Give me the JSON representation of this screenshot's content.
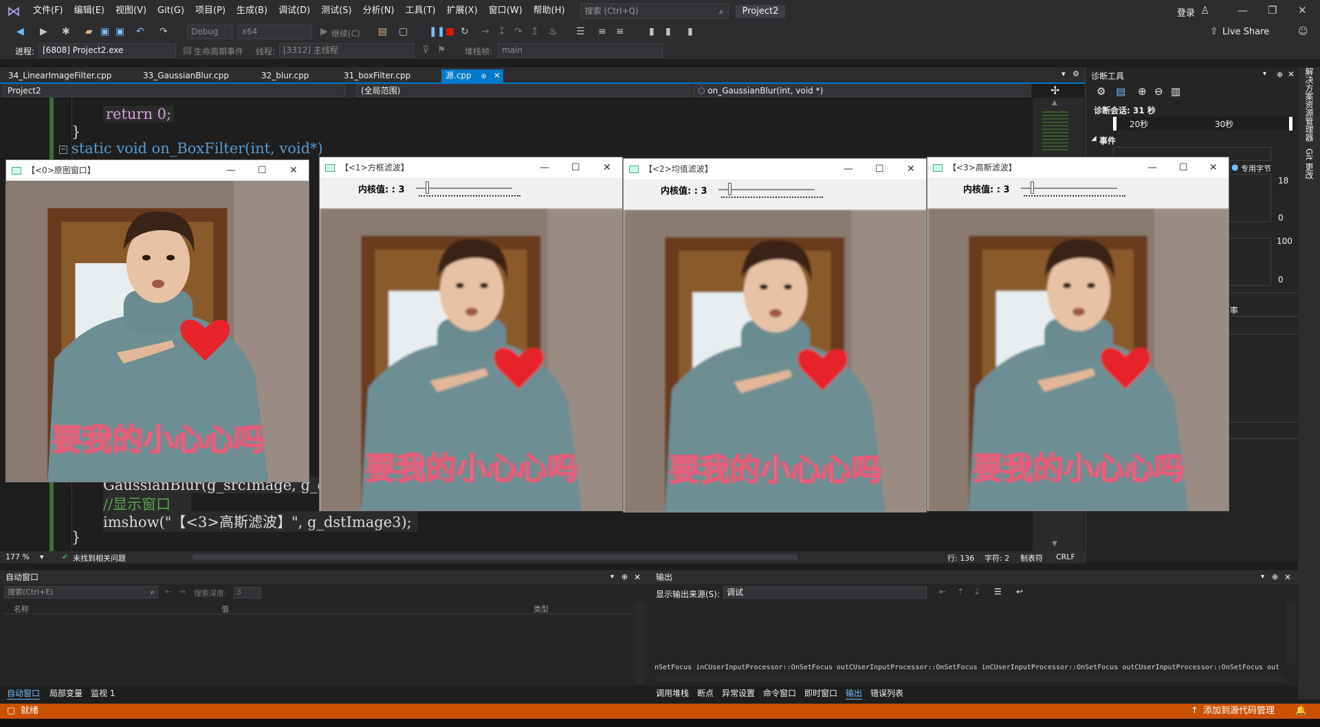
{
  "menu": [
    "文件(F)",
    "编辑(E)",
    "视图(V)",
    "Git(G)",
    "项目(P)",
    "生成(B)",
    "调试(D)",
    "测试(S)",
    "分析(N)",
    "工具(T)",
    "扩展(X)",
    "窗口(W)",
    "帮助(H)"
  ],
  "search_placeholder": "搜索 (Ctrl+Q)",
  "project_name": "Project2",
  "login": "登录",
  "toolbar": {
    "config": "Debug",
    "platform": "x64",
    "continue": "继续(C)",
    "live_share": "Live Share",
    "process_label": "进程:",
    "process_value": "[6808] Project2.exe",
    "lifecycle": "生命周期事件",
    "thread_label": "线程:",
    "thread_value": "[3312] 主线程",
    "stack_label": "堆栈帧:",
    "stack_value": "main"
  },
  "tabs": [
    "34_LinearImageFilter.cpp",
    "33_GaussianBlur.cpp",
    "32_blur.cpp",
    "31_boxFilter.cpp",
    "源.cpp"
  ],
  "nav": {
    "project": "Project2",
    "scope": "(全局范围)",
    "function": "on_GaussianBlur(int, void *)"
  },
  "code": {
    "l1": "return 0;",
    "l2": "}",
    "l3": "static void on_BoxFilter(int, void*)",
    "l4": "GaussianBlur(g_srcImage, g_d",
    "l5": "//显示窗口",
    "l6": "imshow(\"【<3>高斯滤波】\", g_dstImage3);",
    "l7": "}"
  },
  "editor_status": {
    "zoom": "177 %",
    "issues": "未找到相关问题",
    "line": "行: 136",
    "char": "字符: 2",
    "tabs": "制表符",
    "eol": "CRLF"
  },
  "diag": {
    "title": "诊断工具",
    "session": "诊断会话: 31 秒",
    "t20": "20秒",
    "t30": "30秒",
    "events": "事件",
    "private_bytes": "专用字节",
    "v18": "18",
    "v0a": "0",
    "v100": "100",
    "v0b": "0",
    "rate": "率"
  },
  "right_strip": [
    "解决方案资源管理器",
    "Git 更改"
  ],
  "auto_window": {
    "title": "自动窗口",
    "search": "搜索(Ctrl+E)",
    "depth_label": "搜索深度:",
    "depth_value": "3",
    "col_name": "名称",
    "col_value": "值",
    "col_type": "类型"
  },
  "bottom_left_tabs": [
    "自动窗口",
    "局部变量",
    "监视 1"
  ],
  "output": {
    "title": "输出",
    "source_label": "显示输出来源(S):",
    "source_value": "调试",
    "text": "nSetFocus inCUserInputProcessor::OnSetFocus outCUserInputProcessor::OnSetFocus inCUserInputProcessor::OnSetFocus outCUserInputProcessor::OnSetFocus out"
  },
  "bottom_right_tabs": [
    "调用堆栈",
    "断点",
    "异常设置",
    "命令窗口",
    "即时窗口",
    "输出",
    "错误列表"
  ],
  "status": {
    "ready": "就绪",
    "source_control": "添加到源代码管理"
  },
  "cv_windows": [
    {
      "title": "【<0>原图窗口】",
      "has_trackbar": false
    },
    {
      "title": "【<1>方框滤波】",
      "has_trackbar": true,
      "track_label": "内核值: : 3"
    },
    {
      "title": "【<2>均值滤波】",
      "has_trackbar": true,
      "track_label": "内核值: : 3"
    },
    {
      "title": "【<3>高斯滤波】",
      "has_trackbar": true,
      "track_label": "内核值: : 3"
    }
  ],
  "photo_caption": "要我的小心心吗",
  "colors": {
    "accent": "#007acc",
    "status": "#ca5100",
    "keyword": "#569cd6",
    "string": "#d69d85",
    "comment": "#57a64a",
    "number": "#b5cea8",
    "heart": "#e8242b"
  }
}
